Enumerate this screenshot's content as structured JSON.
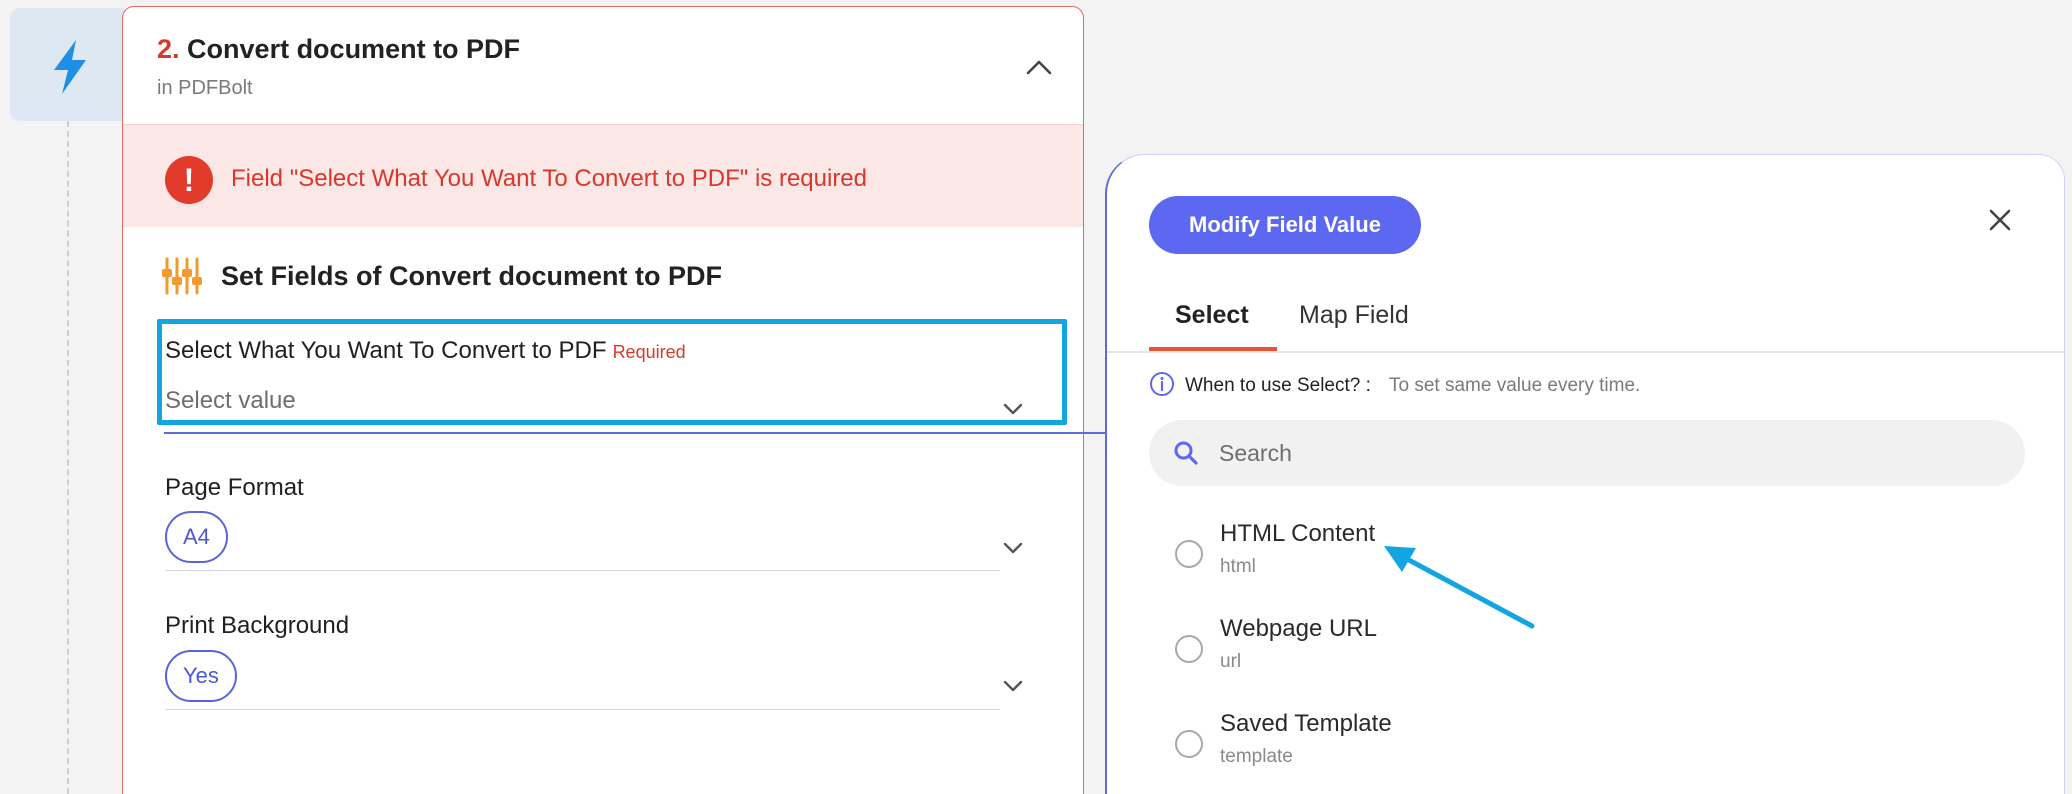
{
  "step": {
    "number": "2.",
    "title": "Convert document to PDF",
    "app": "in PDFBolt"
  },
  "error": {
    "icon": "!",
    "message": "Field \"Select What You Want To Convert to PDF\" is required"
  },
  "section": {
    "title": "Set Fields of Convert document to PDF"
  },
  "fields": {
    "convert_type": {
      "label": "Select What You Want To Convert to PDF",
      "required_label": "Required",
      "placeholder": "Select value"
    },
    "page_format": {
      "label": "Page Format",
      "value": "A4"
    },
    "print_background": {
      "label": "Print Background",
      "value": "Yes"
    }
  },
  "panel": {
    "modify_button": "Modify Field Value",
    "tabs": [
      "Select",
      "Map Field"
    ],
    "active_tab": "Select",
    "hint_question": "When to use Select? :",
    "hint_answer": "To set same value every time.",
    "search_placeholder": "Search",
    "options": [
      {
        "label": "HTML Content",
        "value": "html"
      },
      {
        "label": "Webpage URL",
        "value": "url"
      },
      {
        "label": "Saved Template",
        "value": "template"
      }
    ]
  },
  "colors": {
    "accent": "#5c67f2",
    "error": "#e23a2b",
    "highlight": "#12a5e0",
    "tab_active": "#e4543c",
    "trigger_icon": "#1e8ee6"
  },
  "icons": {
    "trigger": "lightning-bolt-icon",
    "collapse": "chevron-up-icon",
    "error": "exclamation-icon",
    "section": "sliders-icon",
    "dropdown": "chevron-down-icon",
    "close": "close-icon",
    "info": "info-icon",
    "search": "search-icon",
    "annotation": "arrow-annotation"
  }
}
